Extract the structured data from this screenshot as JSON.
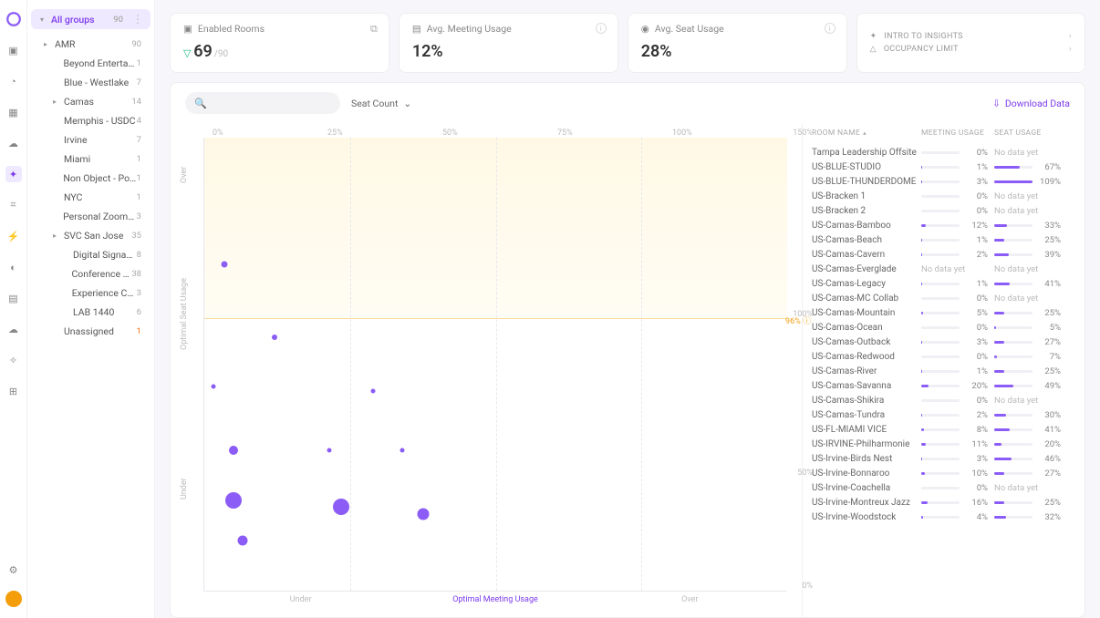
{
  "sidebar_header": {
    "label": "All groups",
    "count": "90"
  },
  "tree": [
    {
      "label": "AMR",
      "count": "90",
      "level": 0,
      "expand": true
    },
    {
      "label": "Beyond Entertain…",
      "count": "1",
      "level": 1
    },
    {
      "label": "Blue - Westlake",
      "count": "7",
      "level": 1
    },
    {
      "label": "Camas",
      "count": "14",
      "level": 1,
      "expand": true
    },
    {
      "label": "Memphis - USDC",
      "count": "4",
      "level": 1
    },
    {
      "label": "Irvine",
      "count": "7",
      "level": 1
    },
    {
      "label": "Miami",
      "count": "1",
      "level": 1
    },
    {
      "label": "Non Object - Port…",
      "count": "1",
      "level": 1
    },
    {
      "label": "NYC",
      "count": "1",
      "level": 1
    },
    {
      "label": "Personal ZoomRo…",
      "count": "3",
      "level": 1
    },
    {
      "label": "SVC San Jose",
      "count": "35",
      "level": 1,
      "expand": true
    },
    {
      "label": "Digital Signage",
      "count": "8",
      "level": 2
    },
    {
      "label": "Conference Roo…",
      "count": "38",
      "level": 2
    },
    {
      "label": "Experience Center",
      "count": "3",
      "level": 2
    },
    {
      "label": "LAB 1440",
      "count": "6",
      "level": 2
    },
    {
      "label": "Unassigned",
      "count": "1",
      "level": 1,
      "orange": true
    }
  ],
  "cards": {
    "enabled": {
      "title": "Enabled Rooms",
      "value": "69",
      "sub": "/90"
    },
    "meeting": {
      "title": "Avg. Meeting Usage",
      "value": "12%"
    },
    "seat": {
      "title": "Avg. Seat Usage",
      "value": "28%"
    },
    "insights": {
      "a": "INTRO TO INSIGHTS",
      "b": "OCCUPANCY LIMIT"
    }
  },
  "toolbar": {
    "sort_label": "Seat Count",
    "download": "Download Data"
  },
  "chart_data": {
    "type": "scatter",
    "xlabel_segments": [
      "Under",
      "Optimal Meeting Usage",
      "Over"
    ],
    "ylabel_top": "Over",
    "ylabel_bot": "Under",
    "ylabel_mid": "Optimal Seat Usage",
    "x_ticks": [
      "0%",
      "25%",
      "50%",
      "75%",
      "100%"
    ],
    "y_ticks": [
      {
        "label": "150%",
        "y": 100
      },
      {
        "label": "100%",
        "y": 60
      },
      {
        "label": "50%",
        "y": 25
      },
      {
        "label": "0%",
        "y": 0
      }
    ],
    "golden_pct": "96%",
    "bubbles": [
      {
        "x": 3.5,
        "y": 72,
        "size": 7
      },
      {
        "x": 12,
        "y": 56,
        "size": 6
      },
      {
        "x": 1.5,
        "y": 45,
        "size": 5
      },
      {
        "x": 29,
        "y": 44,
        "size": 5
      },
      {
        "x": 5,
        "y": 31,
        "size": 10
      },
      {
        "x": 21.5,
        "y": 31,
        "size": 5
      },
      {
        "x": 34,
        "y": 31,
        "size": 5
      },
      {
        "x": 5,
        "y": 20,
        "size": 18
      },
      {
        "x": 23.5,
        "y": 18.5,
        "size": 18
      },
      {
        "x": 37.5,
        "y": 17,
        "size": 13
      },
      {
        "x": 6.5,
        "y": 11,
        "size": 11
      }
    ]
  },
  "table": {
    "headers": {
      "name": "ROOM NAME",
      "mu": "MEETING USAGE",
      "su": "SEAT USAGE"
    },
    "rows": [
      {
        "name": "Tampa Leadership Offsite",
        "mu": 0,
        "su": null
      },
      {
        "name": "US-BLUE-STUDIO",
        "mu": 1,
        "su": 67
      },
      {
        "name": "US-BLUE-THUNDERDOME",
        "mu": 3,
        "su": 109
      },
      {
        "name": "US-Bracken 1",
        "mu": 0,
        "su": null
      },
      {
        "name": "US-Bracken 2",
        "mu": 0,
        "su": null
      },
      {
        "name": "US-Camas-Bamboo",
        "mu": 12,
        "su": 33
      },
      {
        "name": "US-Camas-Beach",
        "mu": 1,
        "su": 25
      },
      {
        "name": "US-Camas-Cavern",
        "mu": 2,
        "su": 39
      },
      {
        "name": "US-Camas-Everglade",
        "mu": null,
        "su": null
      },
      {
        "name": "US-Camas-Legacy",
        "mu": 1,
        "su": 41
      },
      {
        "name": "US-Camas-MC Collab",
        "mu": 0,
        "su": null
      },
      {
        "name": "US-Camas-Mountain",
        "mu": 5,
        "su": 25
      },
      {
        "name": "US-Camas-Ocean",
        "mu": 0,
        "su": 5
      },
      {
        "name": "US-Camas-Outback",
        "mu": 3,
        "su": 27
      },
      {
        "name": "US-Camas-Redwood",
        "mu": 0,
        "su": 7
      },
      {
        "name": "US-Camas-River",
        "mu": 1,
        "su": 25
      },
      {
        "name": "US-Camas-Savanna",
        "mu": 20,
        "su": 49
      },
      {
        "name": "US-Camas-Shikira",
        "mu": 0,
        "su": null
      },
      {
        "name": "US-Camas-Tundra",
        "mu": 2,
        "su": 30
      },
      {
        "name": "US-FL-MIAMI VICE",
        "mu": 8,
        "su": 41
      },
      {
        "name": "US-IRVINE-Philharmonie",
        "mu": 11,
        "su": 20
      },
      {
        "name": "US-Irvine-Birds Nest",
        "mu": 3,
        "su": 46
      },
      {
        "name": "US-Irvine-Bonnaroo",
        "mu": 10,
        "su": 27
      },
      {
        "name": "US-Irvine-Coachella",
        "mu": 0,
        "su": null
      },
      {
        "name": "US-Irvine-Montreux Jazz",
        "mu": 16,
        "su": 25
      },
      {
        "name": "US-Irvine-Woodstock",
        "mu": 4,
        "su": 32
      }
    ],
    "no_data_label": "No data yet"
  }
}
